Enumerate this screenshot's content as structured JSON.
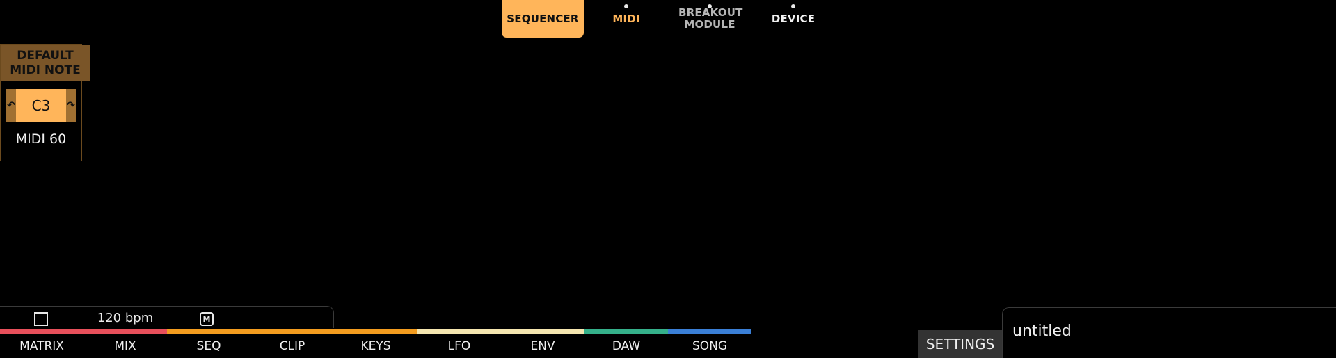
{
  "top_tabs": [
    {
      "label": "SEQUENCER",
      "active": true
    },
    {
      "label": "MIDI"
    },
    {
      "label": "BREAKOUT MODULE"
    },
    {
      "label": "DEVICE"
    }
  ],
  "parameter": {
    "title": "DEFAULT MIDI NOTE",
    "note": "C3",
    "midi_value": "MIDI 60",
    "dec_icon": "undo-arrow-icon",
    "inc_icon": "redo-arrow-icon"
  },
  "transport": {
    "tempo": "120 bpm",
    "metronome_label": "M"
  },
  "bottom_nav": [
    {
      "label": "MATRIX",
      "color": "#e8505b"
    },
    {
      "label": "MIX",
      "color": "#e8505b"
    },
    {
      "label": "SEQ",
      "color": "#f39c1f"
    },
    {
      "label": "CLIP",
      "color": "#f39c1f"
    },
    {
      "label": "KEYS",
      "color": "#f39c1f"
    },
    {
      "label": "LFO",
      "color": "#f5e6b0"
    },
    {
      "label": "ENV",
      "color": "#f5e6b0"
    },
    {
      "label": "DAW",
      "color": "#35b08a"
    },
    {
      "label": "SONG",
      "color": "#3a7fd6"
    }
  ],
  "settings_label": "SETTINGS",
  "project_name": "untitled",
  "colors": {
    "accent": "#ffb55a",
    "header": "#7a5528"
  }
}
